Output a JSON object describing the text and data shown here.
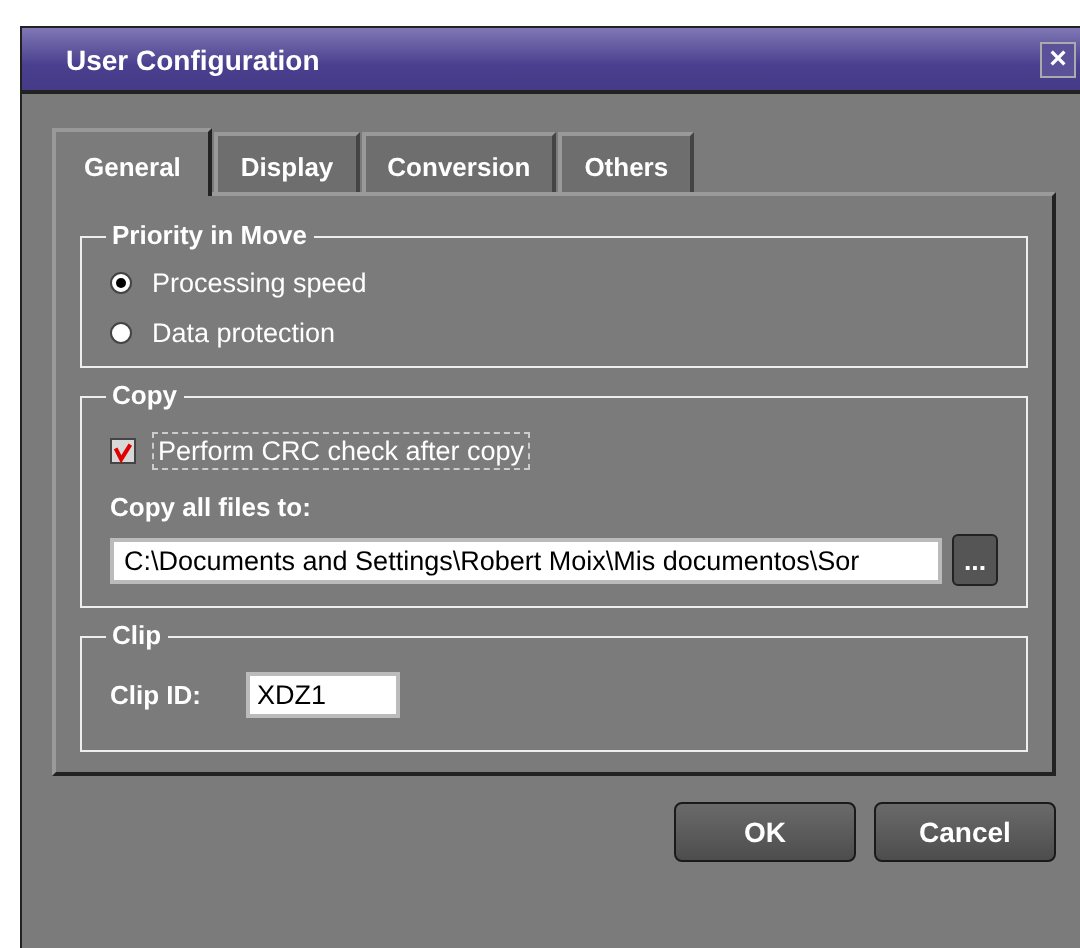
{
  "window": {
    "title": "User Configuration",
    "close": "×"
  },
  "tabs": [
    {
      "label": "General",
      "selected": true
    },
    {
      "label": "Display",
      "selected": false
    },
    {
      "label": "Conversion",
      "selected": false
    },
    {
      "label": "Others",
      "selected": false
    }
  ],
  "priority_in_move": {
    "title": "Priority in Move",
    "options": [
      {
        "label": "Processing speed",
        "selected": true
      },
      {
        "label": "Data protection",
        "selected": false
      }
    ]
  },
  "copy": {
    "title": "Copy",
    "crc_check": {
      "label": "Perform CRC check after copy",
      "checked": true
    },
    "destination_label": "Copy all files to:",
    "destination_value": "C:\\Documents and Settings\\Robert Moix\\Mis documentos\\Sor",
    "browse_button": "..."
  },
  "clip": {
    "title": "Clip",
    "clip_id_label": "Clip ID:",
    "clip_id_value": "XDZ1"
  },
  "buttons": [
    "OK",
    "Cancel"
  ]
}
